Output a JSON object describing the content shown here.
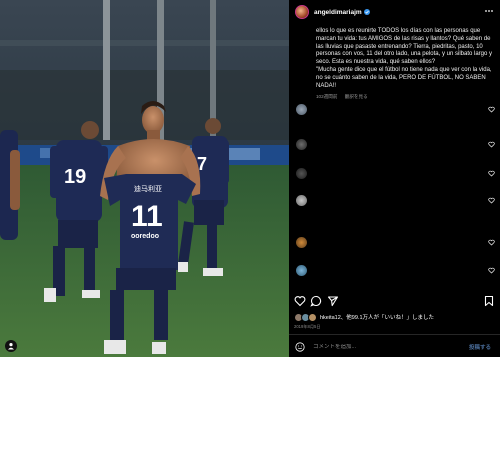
{
  "post": {
    "username": "angeldimariajm",
    "caption_lines": [
      "ellos lo que es reunirte TODOS los días con las personas que marcan tu vida: tus AMIGOS de las risas y llantos? Qué saben de las lluvias que pasaste entrenando? Tierra, piedritas, pasto, 10 personas con vos, 11 del otro lado, una pelota, y un silbato largo y seco. Esta es nuestra vida, qué saben ellos?",
      "\"Mucha gente dice que el fútbol no tiene nada que ver con la vida, no se cuánto saben de la vida, PERO DE FÚTBOL, NO SABEN NADA!!"
    ],
    "caption_time": "102週間前",
    "translate_label": "翻訳を見る",
    "likes_text": "hkeita12、他99.1万人が「いいね！」しました",
    "date": "2019年8月5日",
    "comment_placeholder": "コメントを追加...",
    "post_label": "投稿する"
  },
  "photo": {
    "jersey_name": "迪马利亚",
    "jersey_number": "11",
    "jersey_sponsor": "ooredoo",
    "bg_player_numbers": [
      "19",
      "7"
    ]
  },
  "colors": {
    "panel_bg": "#000000",
    "jersey": "#1f2b55",
    "pitch": "#3d6b3a",
    "post_link": "#4a6d9a"
  }
}
